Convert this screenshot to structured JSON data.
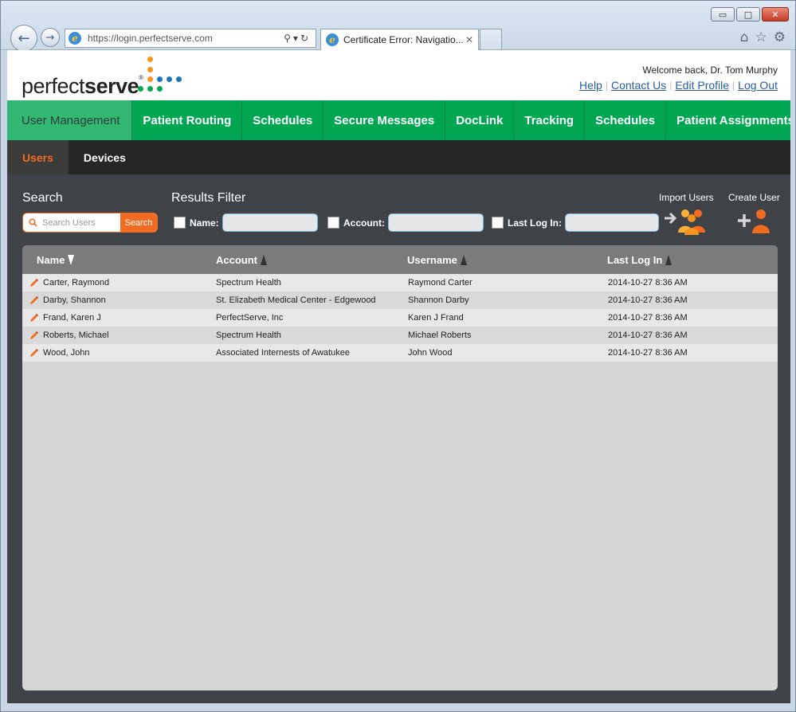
{
  "browser": {
    "url": "https://login.perfectserve.com",
    "tab_title": "Certificate Error: Navigatio...",
    "minimize": "▭",
    "maximize": "□",
    "close": "✕"
  },
  "header": {
    "logo_regular": "perfect",
    "logo_bold": "serve",
    "logo_mark": "®",
    "welcome": "Welcome back, Dr. Tom Murphy",
    "links": [
      "Help",
      "Contact Us",
      "Edit Profile",
      "Log Out"
    ]
  },
  "mainnav": [
    "User Management",
    "Patient Routing",
    "Schedules",
    "Secure Messages",
    "DocLink",
    "Tracking",
    "Schedules",
    "Patient Assignments"
  ],
  "subnav": [
    "Users",
    "Devices"
  ],
  "search": {
    "title": "Search",
    "placeholder": "Search Users",
    "button": "Search"
  },
  "filter": {
    "title": "Results Filter",
    "name_label": "Name:",
    "account_label": "Account:",
    "lastlogin_label": "Last Log In:"
  },
  "actions": {
    "import": "Import Users",
    "create": "Create User"
  },
  "table": {
    "columns": [
      "Name",
      "Account",
      "Username",
      "Last Log In"
    ],
    "rows": [
      {
        "name": "Carter, Raymond",
        "account": "Spectrum Health",
        "username": "Raymond Carter",
        "last": "2014-10-27 8:36 AM"
      },
      {
        "name": "Darby, Shannon",
        "account": "St. Elizabeth Medical Center - Edgewood",
        "username": "Shannon Darby",
        "last": "2014-10-27 8:36 AM"
      },
      {
        "name": "Frand, Karen J",
        "account": "PerfectServe, Inc",
        "username": "Karen J Frand",
        "last": "2014-10-27 8:36 AM"
      },
      {
        "name": "Roberts, Michael",
        "account": "Spectrum Health",
        "username": "Michael Roberts",
        "last": "2014-10-27 8:36 AM"
      },
      {
        "name": "Wood, John",
        "account": "Associated Internests of Awatukee",
        "username": "John Wood",
        "last": "2014-10-27 8:36 AM"
      }
    ]
  },
  "colors": {
    "nav_green": "#00a651",
    "accent_orange": "#f26b22",
    "link_blue": "#2a5d9e"
  }
}
